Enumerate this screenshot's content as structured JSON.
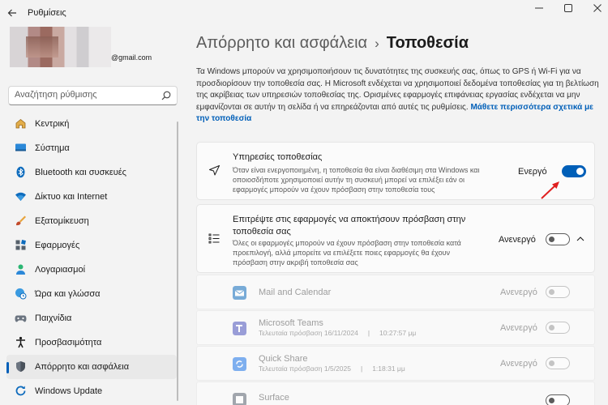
{
  "window": {
    "title": "Ρυθμίσεις"
  },
  "user": {
    "email": "@gmail.com"
  },
  "search": {
    "placeholder": "Αναζήτηση ρύθμισης"
  },
  "sidebar": {
    "items": [
      {
        "label": "Κεντρική",
        "icon": "home-icon"
      },
      {
        "label": "Σύστημα",
        "icon": "system-icon"
      },
      {
        "label": "Bluetooth και συσκευές",
        "icon": "bluetooth-icon"
      },
      {
        "label": "Δίκτυο και Internet",
        "icon": "wifi-icon"
      },
      {
        "label": "Εξατομίκευση",
        "icon": "brush-icon"
      },
      {
        "label": "Εφαρμογές",
        "icon": "apps-icon"
      },
      {
        "label": "Λογαριασμοί",
        "icon": "account-icon"
      },
      {
        "label": "Ώρα και γλώσσα",
        "icon": "globe-clock-icon"
      },
      {
        "label": "Παιχνίδια",
        "icon": "gamepad-icon"
      },
      {
        "label": "Προσβασιμότητα",
        "icon": "accessibility-icon"
      },
      {
        "label": "Απόρρητο και ασφάλεια",
        "icon": "shield-icon",
        "active": true
      },
      {
        "label": "Windows Update",
        "icon": "update-icon"
      }
    ]
  },
  "breadcrumb": {
    "parent": "Απόρρητο και ασφάλεια",
    "separator": "›",
    "current": "Τοποθεσία"
  },
  "intro": {
    "text": "Τα Windows μπορούν να χρησιμοποιήσουν τις δυνατότητες της συσκευής σας, όπως το GPS ή Wi-Fi για να προσδιορίσουν την τοποθεσία σας. Η Microsoft ενδέχεται να χρησιμοποιεί δεδομένα τοποθεσίας για τη βελτίωση της ακρίβειας των υπηρεσιών τοποθεσίας της. Ορισμένες εφαρμογές επιφάνειας εργασίας ενδέχεται να μην εμφανίζονται σε αυτήν τη σελίδα ή να επηρεάζονται από αυτές τις ρυθμίσεις.",
    "link": "Μάθετε περισσότερα σχετικά με την τοποθεσία"
  },
  "location_services": {
    "title": "Υπηρεσίες τοποθεσίας",
    "description": "Όταν είναι ενεργοποιημένη, η τοποθεσία θα είναι διαθέσιμη στα Windows και οποιοσδήποτε χρησιμοποιεί αυτήν τη συσκευή μπορεί να επιλέξει εάν οι εφαρμογές μπορούν να έχουν πρόσβαση στην τοποθεσία τους",
    "state": "Ενεργό",
    "on": true
  },
  "app_access": {
    "title": "Επιτρέψτε στις εφαρμογές να αποκτήσουν πρόσβαση στην τοποθεσία σας",
    "description": "Όλες οι εφαρμογές μπορούν να έχουν πρόσβαση στην τοποθεσία κατά προεπιλογή, αλλά μπορείτε να επιλέξετε ποιες εφαρμογές θα έχουν πρόσβαση στην ακριβή τοποθεσία σας",
    "state": "Ανενεργό",
    "on": false
  },
  "apps": [
    {
      "name": "Mail and Calendar",
      "last_access_label": "",
      "date": "",
      "time": "",
      "state": "Ανενεργό",
      "color": "#0f6cbd"
    },
    {
      "name": "Microsoft Teams",
      "last_access_label": "Τελευταία πρόσβαση",
      "date": "16/11/2024",
      "time": "10:27:57 μμ",
      "state": "Ανενεργό",
      "color": "#4b53bc"
    },
    {
      "name": "Quick Share",
      "last_access_label": "Τελευταία πρόσβαση",
      "date": "1/5/2025",
      "time": "1:18:31 μμ",
      "state": "Ανενεργό",
      "color": "#1a73e8"
    },
    {
      "name": "Surface",
      "last_access_label": "",
      "date": "",
      "time": "",
      "state": "",
      "color": "#5a6470"
    }
  ],
  "colors": {
    "accent": "#005fb8",
    "annotation_arrow": "#e02020"
  }
}
